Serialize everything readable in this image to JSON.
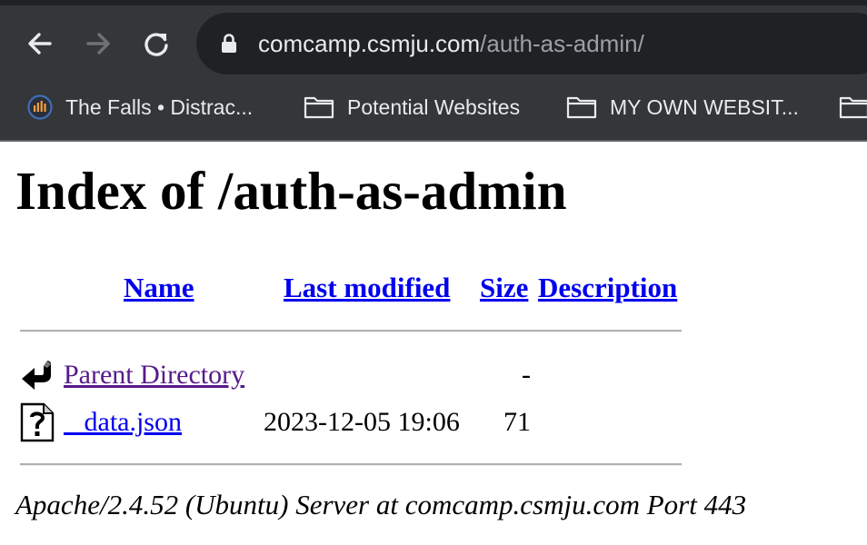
{
  "browser": {
    "url_host": "comcamp.csmju.com",
    "url_path": "/auth-as-admin/",
    "bookmarks": [
      {
        "label": "The Falls • Distrac...",
        "icon": "podcast-bars-icon"
      },
      {
        "label": "Potential Websites",
        "icon": "folder-icon"
      },
      {
        "label": "MY OWN WEBSIT...",
        "icon": "folder-icon"
      },
      {
        "label": "",
        "icon": "folder-icon"
      }
    ],
    "colors": {
      "chrome": "#35363a",
      "omnibox": "#202124",
      "text": "#e8eaed",
      "muted": "#9aa0a6"
    }
  },
  "page": {
    "title": "Index of /auth-as-admin",
    "columns": {
      "name": "Name",
      "last_modified": "Last modified",
      "size": "Size",
      "description": "Description"
    },
    "rows": [
      {
        "icon": "back-arrow-icon",
        "name": "Parent Directory",
        "last_modified": "",
        "size": "-",
        "description": ""
      },
      {
        "icon": "unknown-file-icon",
        "name": "   data.json",
        "last_modified": "2023-12-05 19:06",
        "size": "71",
        "description": ""
      }
    ],
    "footer": "Apache/2.4.52 (Ubuntu) Server at comcamp.csmju.com Port 443",
    "colors": {
      "link": "#0000ee",
      "visited": "#551a8b"
    }
  }
}
